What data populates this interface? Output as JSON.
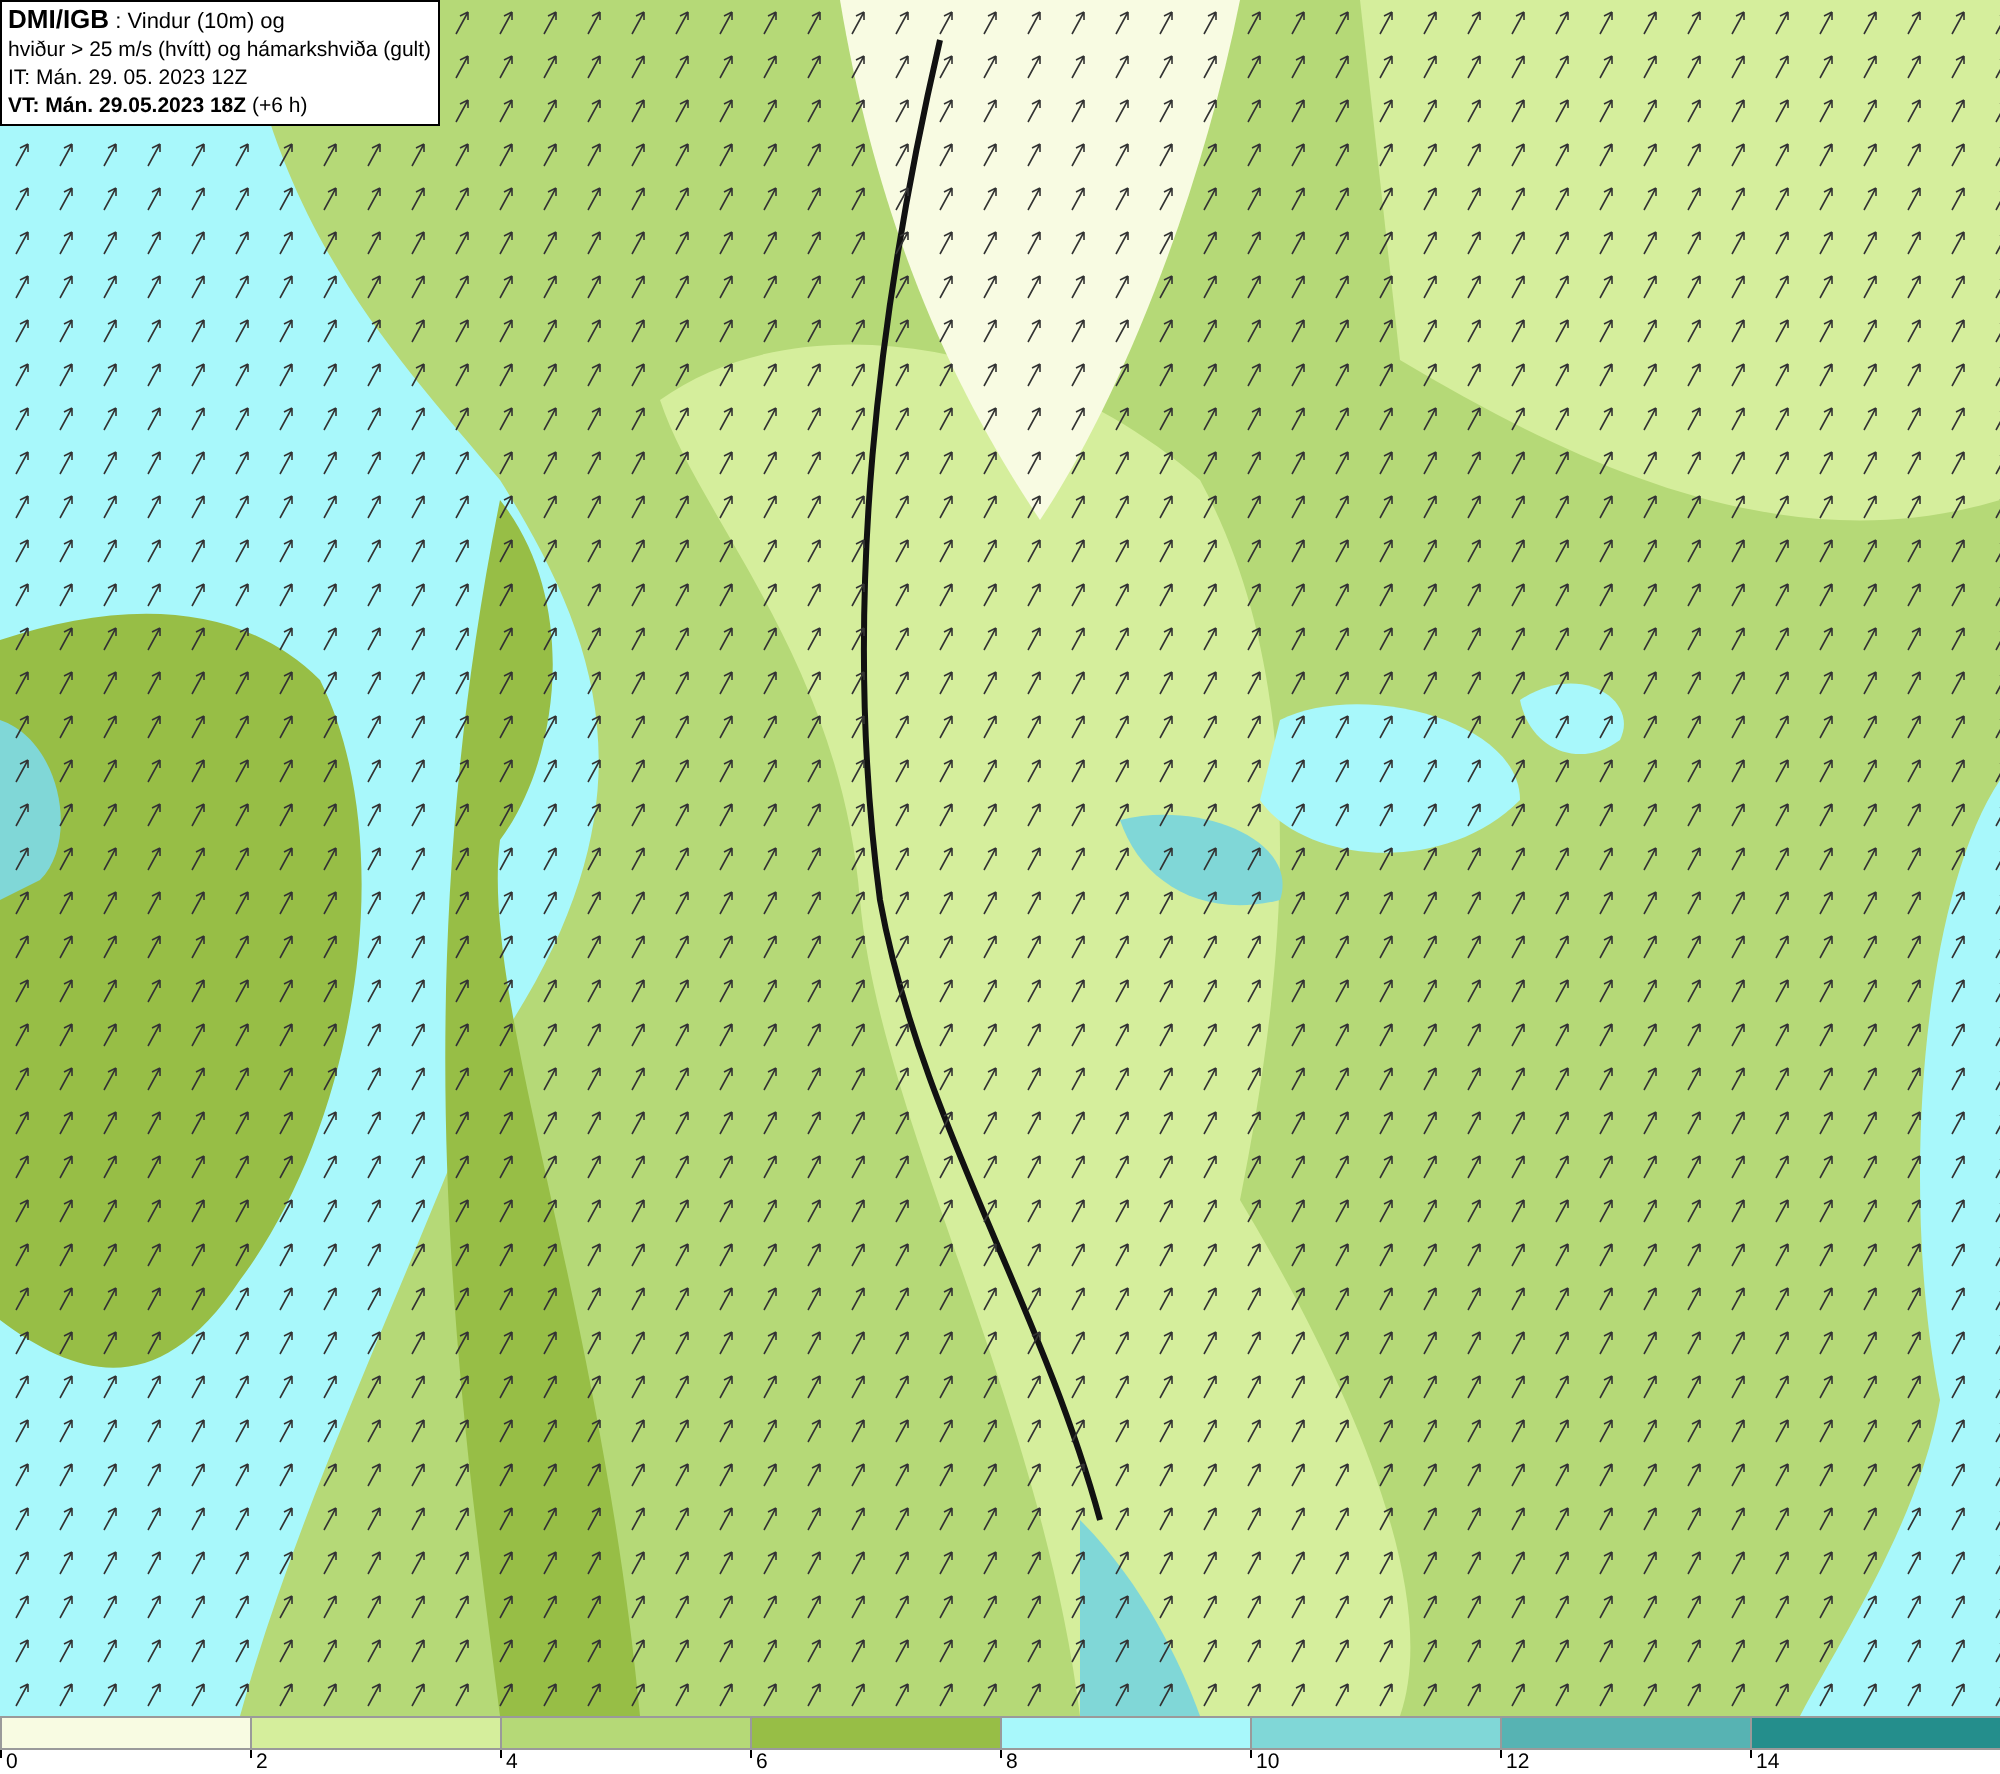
{
  "header": {
    "lines": [
      "**DMI/IGB** : Vindur (10m) og",
      "hviður > 25 m/s (hvítt) og hámarkshviða (gult)",
      "IT: Mán. 29. 05. 2023 12Z",
      "**VT: Mán. 29.05.2023 18Z** (+6 h)"
    ]
  },
  "legend": [
    {
      "label": "0",
      "color": "#f8fbe2"
    },
    {
      "label": "2",
      "color": "#d5ee9c"
    },
    {
      "label": "4",
      "color": "#b5d977"
    },
    {
      "label": "6",
      "color": "#97be46"
    },
    {
      "label": "8",
      "color": "#a8f8fb"
    },
    {
      "label": "10",
      "color": "#80d7d7"
    },
    {
      "label": "12",
      "color": "#57b3b3"
    },
    {
      "label": "14",
      "color": "#248e8c"
    }
  ]
}
